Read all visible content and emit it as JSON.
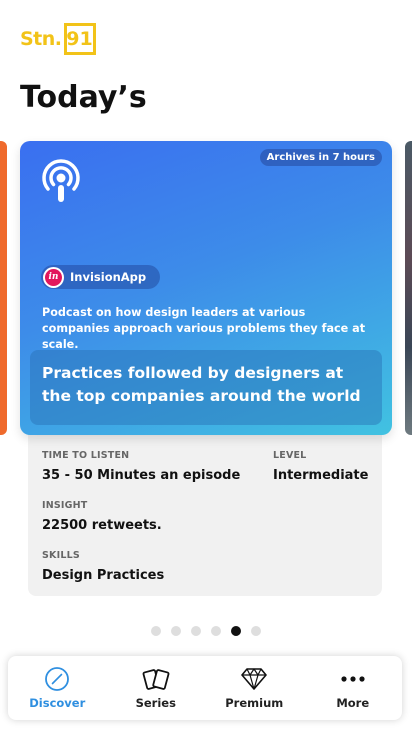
{
  "brand": {
    "text": "Stn.",
    "number": "91"
  },
  "page_title": "Today’s",
  "card": {
    "archive_badge": "Archives in 7 hours",
    "app_logo_text": "in",
    "app_name": "InvisionApp",
    "description": "Podcast on how design leaders at various companies approach various problems they face at scale.",
    "headline": "Practices followed by designers at the top companies around the world"
  },
  "details": {
    "time_label": "TIME TO LISTEN",
    "time_value": "35 - 50 Minutes an episode",
    "level_label": "LEVEL",
    "level_value": "Intermediate",
    "insight_label": "INSIGHT",
    "insight_value": "22500 retweets.",
    "skills_label": "SKILLS",
    "skills_value": "Design Practices"
  },
  "pagination": {
    "total": 6,
    "active_index": 4
  },
  "tabs": [
    {
      "label": "Discover",
      "icon": "compass-icon",
      "active": true
    },
    {
      "label": "Series",
      "icon": "cards-icon",
      "active": false
    },
    {
      "label": "Premium",
      "icon": "diamond-icon",
      "active": false
    },
    {
      "label": "More",
      "icon": "more-dots-icon",
      "active": false
    }
  ],
  "colors": {
    "brand_yellow": "#f2c318",
    "accent_blue": "#2f8fe0",
    "card_gradient_start": "#3a6ff0",
    "card_gradient_end": "#41c2e1"
  }
}
